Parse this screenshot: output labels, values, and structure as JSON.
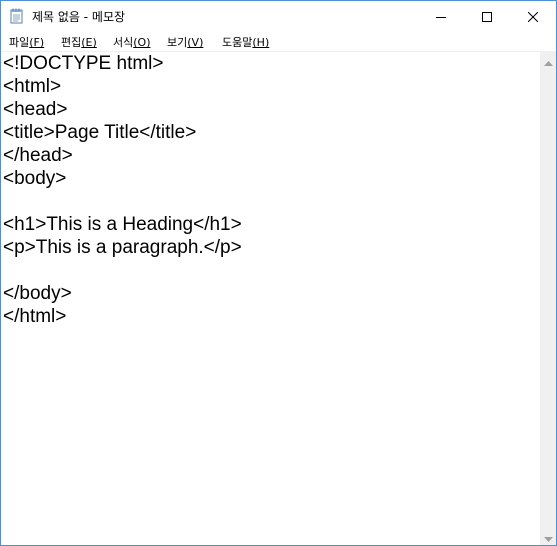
{
  "window": {
    "title": "제목 없음 - 메모장",
    "app_icon": "notepad-icon",
    "controls": {
      "minimize_icon": "minimize-icon",
      "maximize_icon": "maximize-icon",
      "close_icon": "close-icon"
    }
  },
  "menu": [
    {
      "label": "파일",
      "accel": "(F)"
    },
    {
      "label": "편집",
      "accel": "(E)"
    },
    {
      "label": "서식",
      "accel": "(O)"
    },
    {
      "label": "보기",
      "accel": "(V)"
    },
    {
      "label": "도움말",
      "accel": "(H)"
    }
  ],
  "editor": {
    "content": "<!DOCTYPE html>\n<html>\n<head>\n<title>Page Title</title>\n</head>\n<body>\n\n<h1>This is a Heading</h1>\n<p>This is a paragraph.</p>\n\n</body>\n</html>"
  },
  "scrollbar": {
    "up_icon": "scroll-up-arrow-icon",
    "down_icon": "scroll-down-arrow-icon"
  },
  "colors": {
    "window_border": "#4a90d9",
    "scrollbar_track": "#f0f0f0",
    "arrow": "#a0a0a0",
    "text": "#000000"
  }
}
